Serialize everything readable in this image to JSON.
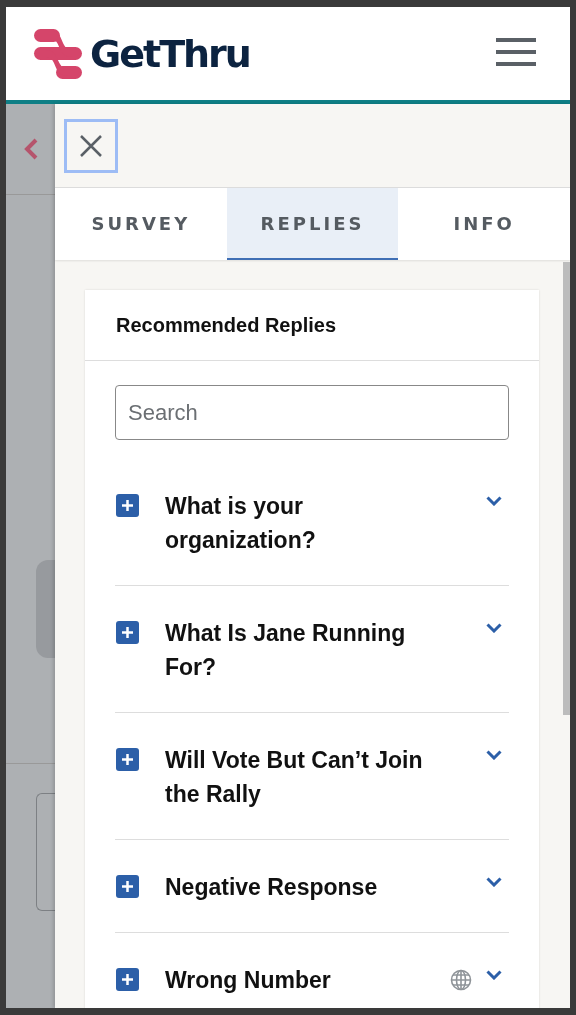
{
  "header": {
    "logo_text": "GetThru"
  },
  "tabs": [
    {
      "label": "SURVEY",
      "selected": false
    },
    {
      "label": "REPLIES",
      "selected": true
    },
    {
      "label": "INFO",
      "selected": false
    }
  ],
  "card": {
    "title": "Recommended Replies",
    "search": {
      "placeholder": "Search"
    },
    "replies": [
      {
        "title": "What is your organization?",
        "globe": false
      },
      {
        "title": "What Is Jane Running For?",
        "globe": false
      },
      {
        "title": "Will Vote But Can’t Join the Rally",
        "globe": false
      },
      {
        "title": "Negative Response",
        "globe": false
      },
      {
        "title": "Wrong Number",
        "globe": true
      }
    ]
  }
}
